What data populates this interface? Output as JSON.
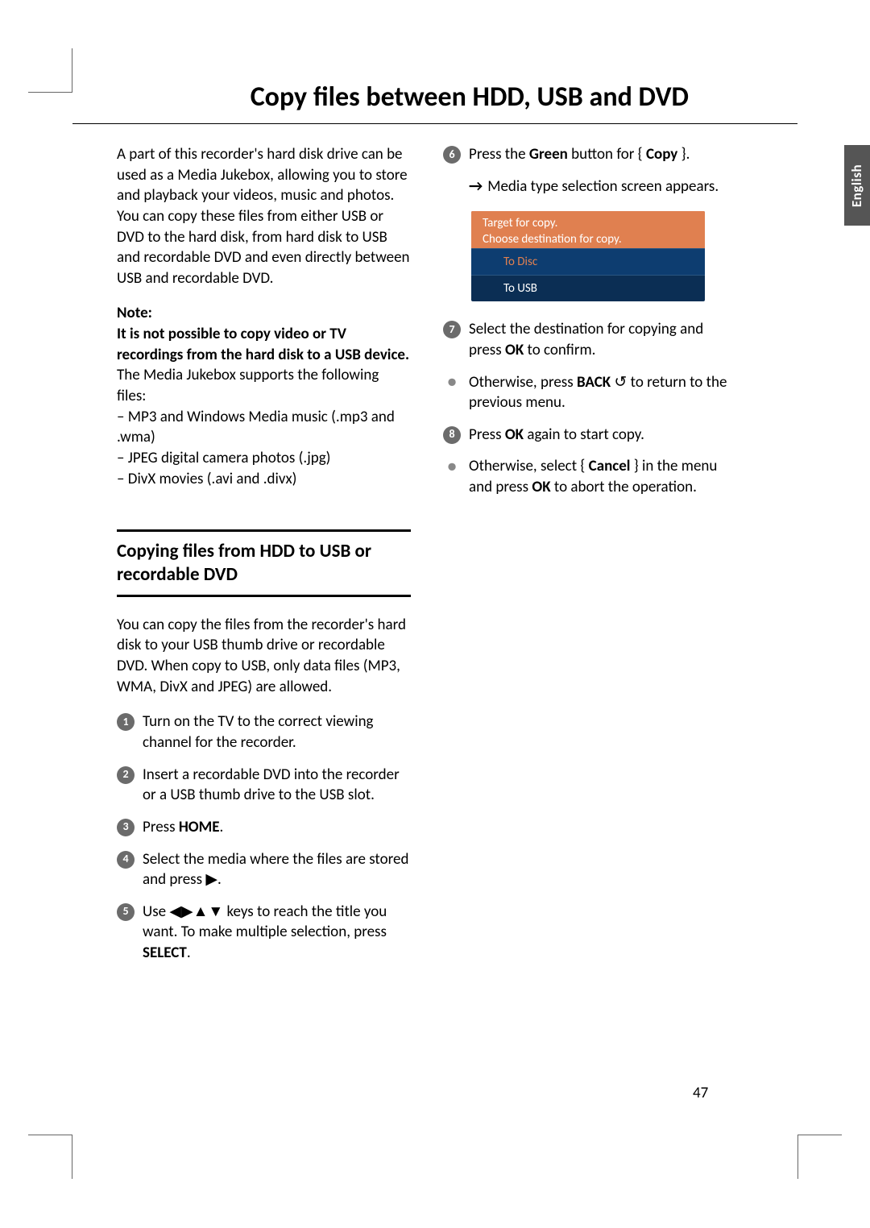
{
  "title": "Copy files between HDD, USB and DVD",
  "language_tab": "English",
  "page_number": "47",
  "intro": "A part of this recorder's hard disk drive can be used as a Media Jukebox, allowing you to store and playback your videos, music and photos.  You can copy these files from either USB or DVD to the hard disk, from hard disk to USB and recordable DVD and even directly between USB and recordable DVD.",
  "note": {
    "label": "Note:",
    "bold": "It is not possible to copy video or TV recordings from the hard disk to a USB device.",
    "plain": "The Media Jukebox supports the following files:",
    "items": [
      "– MP3 and Windows Media music (.mp3 and .wma)",
      "– JPEG digital camera photos (.jpg)",
      "– DivX movies (.avi and .divx)"
    ]
  },
  "section_heading": "Copying files from HDD to USB or recordable DVD",
  "section_intro": "You can copy the files from the recorder's hard disk to your USB thumb drive or recordable DVD.  When copy to USB, only data files (MP3, WMA, DivX and JPEG) are allowed.",
  "steps_left": [
    {
      "n": "1",
      "text": "Turn on the TV to the correct viewing channel for the recorder."
    },
    {
      "n": "2",
      "text": "Insert a recordable DVD into the recorder or a USB thumb drive to the USB slot."
    },
    {
      "n": "3",
      "pre": "Press ",
      "bold": "HOME",
      "post": "."
    },
    {
      "n": "4",
      "pre": "Select the media where the files are stored and press ",
      "icon": "▶",
      "post": "."
    },
    {
      "n": "5",
      "pre": "Use ",
      "icon": "◀▶▲▼",
      "mid": " keys to reach the title you want.  To make multiple selection, press ",
      "bold": "SELECT",
      "post": "."
    }
  ],
  "step6": {
    "n": "6",
    "pre": "Press the ",
    "bold1": "Green",
    "mid": " button for { ",
    "bold2": "Copy",
    "post": " }."
  },
  "step6_sub": "Media type selection screen appears.",
  "dialog": {
    "title": "Target for copy.",
    "subtitle": "Choose destination for copy.",
    "options": [
      "To Disc",
      "To USB"
    ],
    "selected": 0
  },
  "step7": {
    "n": "7",
    "pre": "Select the destination for copying and press ",
    "bold": "OK",
    "post": " to confirm."
  },
  "bullet7": {
    "pre": "Otherwise, press ",
    "bold": "BACK",
    "icon": " ↺",
    "post": " to return to the previous menu."
  },
  "step8": {
    "n": "8",
    "pre": "Press ",
    "bold": "OK",
    "post": " again to start copy."
  },
  "bullet8": {
    "pre": "Otherwise, select { ",
    "bold1": "Cancel",
    "mid": " } in the menu and press ",
    "bold2": "OK",
    "post": " to abort the operation."
  }
}
